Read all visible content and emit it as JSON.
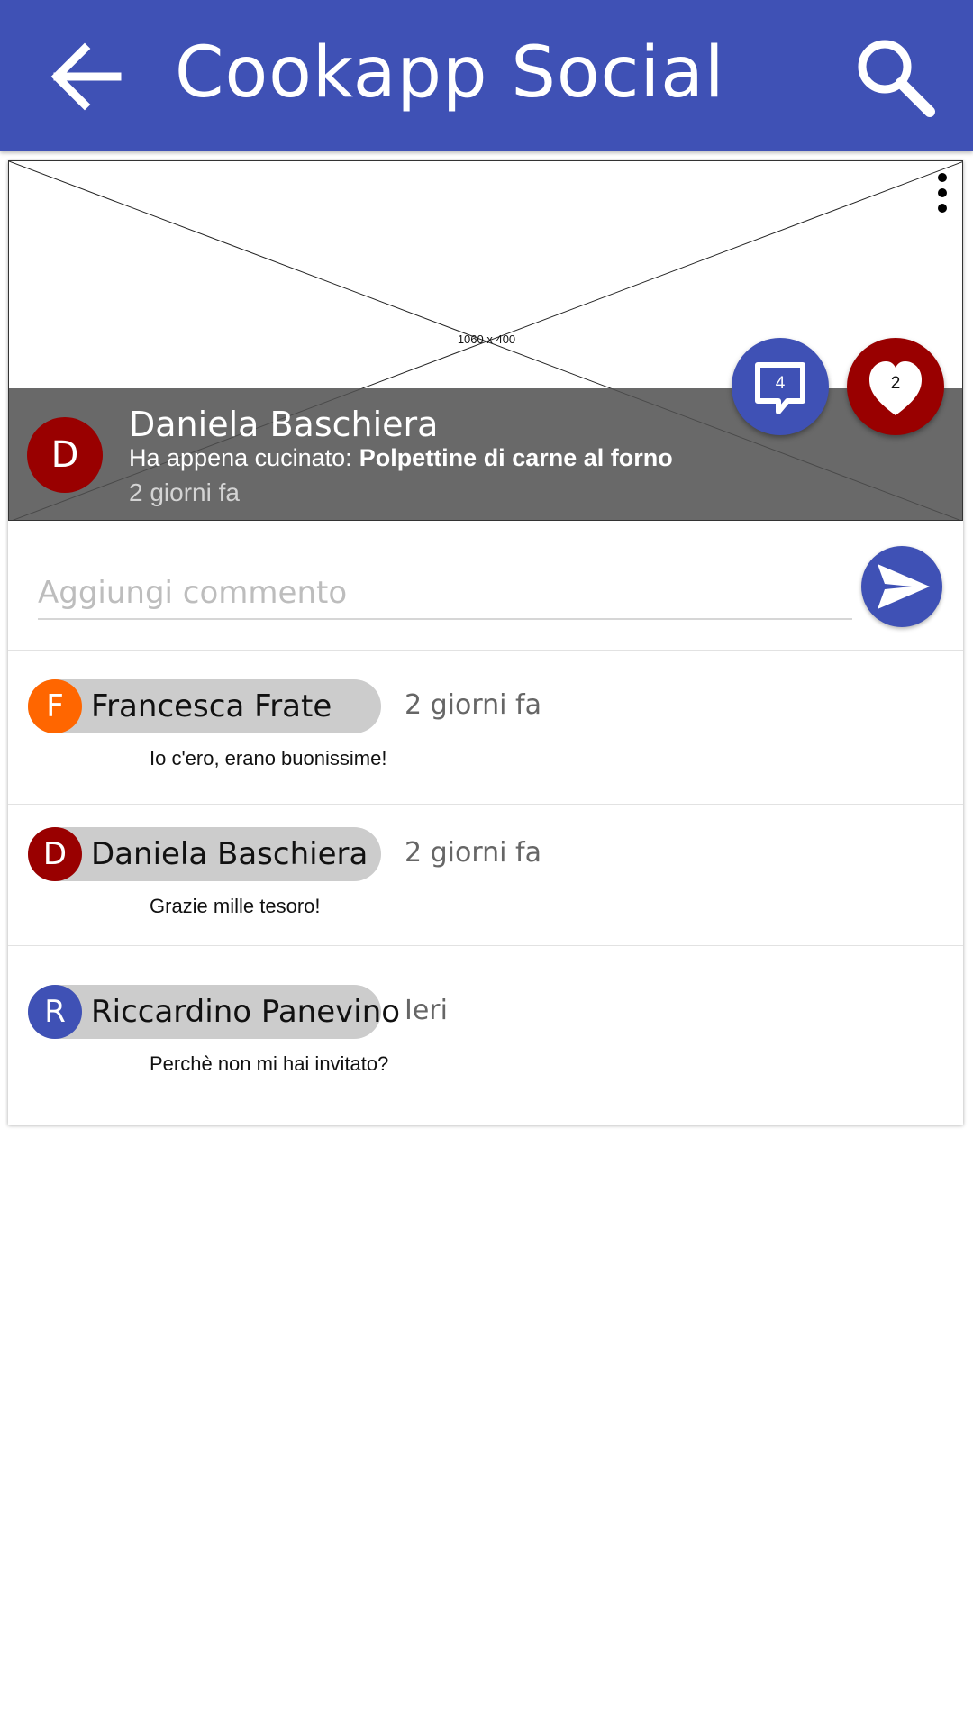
{
  "app_bar": {
    "title": "Cookapp Social",
    "back_icon": "arrow-back-icon",
    "search_icon": "search-icon",
    "color": "#3f51b5"
  },
  "post": {
    "image_placeholder": "1060 x 400",
    "menu_icon": "more-vert-icon",
    "author": {
      "name": "Daniela Baschiera",
      "initial": "D",
      "color": "#990000"
    },
    "action_label": "Ha appena cucinato:",
    "recipe": "Polpettine di carne al forno",
    "time": "2 giorni fa",
    "comments_count": "4",
    "likes_count": "2",
    "comments_icon": "comment-icon",
    "likes_icon": "heart-icon"
  },
  "composer": {
    "placeholder": "Aggiungi commento",
    "value": "",
    "send_icon": "send-icon"
  },
  "comments": [
    {
      "initial": "F",
      "name": "Francesca Frate",
      "time": "2 giorni fa",
      "text": "Io c'ero, erano buonissime!",
      "color": "#ff6600"
    },
    {
      "initial": "D",
      "name": "Daniela Baschiera",
      "time": "2 giorni fa",
      "text": "Grazie mille tesoro!",
      "color": "#990000"
    },
    {
      "initial": "R",
      "name": "Riccardino Panevino",
      "time": "Ieri",
      "text": "Perchè non mi hai invitato?",
      "color": "#3f51b5"
    }
  ]
}
